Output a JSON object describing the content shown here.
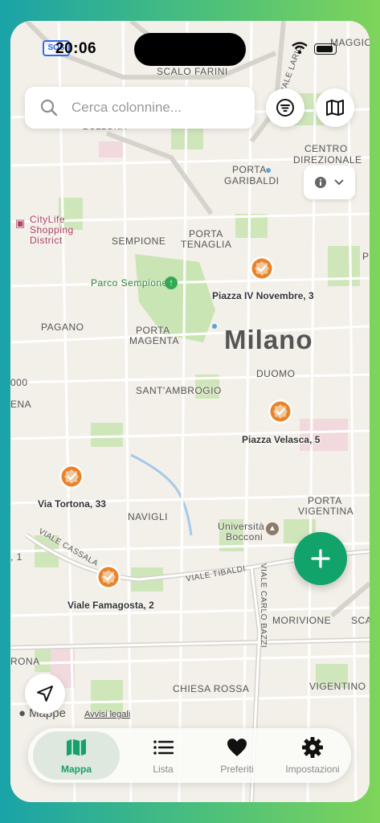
{
  "status_bar": {
    "time": "20:06",
    "sos": "SOS"
  },
  "search": {
    "placeholder": "Cerca colonnine..."
  },
  "map": {
    "city_label": "Milano",
    "labels": {
      "scalo_farini": "SCALO FARINI",
      "viale_lario": "VIALE LARIO",
      "maggiol": "MAGGIOL",
      "centro_direzionale_1": "CENTRO",
      "centro_direzionale_2": "DIREZIONALE",
      "porta_garibaldi_1": "PORTA",
      "porta_garibaldi_2": "GARIBALDI",
      "bullona": "BULLONA",
      "citylife_1": "CityLife",
      "citylife_2": "Shopping",
      "citylife_3": "District",
      "sempione": "SEMPIONE",
      "porta_tenaglia_1": "PORTA",
      "porta_tenaglia_2": "TENAGLIA",
      "parco_sempione": "Parco Sempione",
      "pagano": "PAGANO",
      "porta_magenta_1": "PORTA",
      "porta_magenta_2": "MAGENTA",
      "duomo": "DUOMO",
      "santambrogio": "SANT'AMBROGIO",
      "navigli": "NAVIGLI",
      "universita_1": "Università",
      "universita_2": "Bocconi",
      "porta_vigentina_1": "PORTA",
      "porta_vigentina_2": "VIGENTINA",
      "viale_cassala": "VIALE CASSALA",
      "viale_tibaldi": "VIALE TIBALDI",
      "viale_carlo_bazzi": "VIALE CARLO BAZZI",
      "morivione": "MORIVIONE",
      "sca": "SCA",
      "chiesa_rossa": "CHIESA ROSSA",
      "vigentino": "VIGENTINO",
      "left_edge_1": "000",
      "left_edge_2": "ENA",
      "left_edge_3": ", 1",
      "left_edge_4": "RONA",
      "right_edge": "P"
    },
    "pins": [
      {
        "label": "Piazza IV Novembre, 3"
      },
      {
        "label": "Piazza Velasca, 5"
      },
      {
        "label": "Via Tortona, 33"
      },
      {
        "label": "Viale Famagosta, 2"
      }
    ],
    "pin_color": "#e8832a",
    "attribution": "Mappe",
    "legal_link": "Avvisi legali"
  },
  "tabs": [
    {
      "label": "Mappa",
      "icon": "map-icon",
      "active": true
    },
    {
      "label": "Lista",
      "icon": "list-icon",
      "active": false
    },
    {
      "label": "Preferiti",
      "icon": "heart-icon",
      "active": false
    },
    {
      "label": "Impostazioni",
      "icon": "gear-icon",
      "active": false
    }
  ],
  "colors": {
    "accent": "#17a169",
    "fab": "#11a36a"
  }
}
